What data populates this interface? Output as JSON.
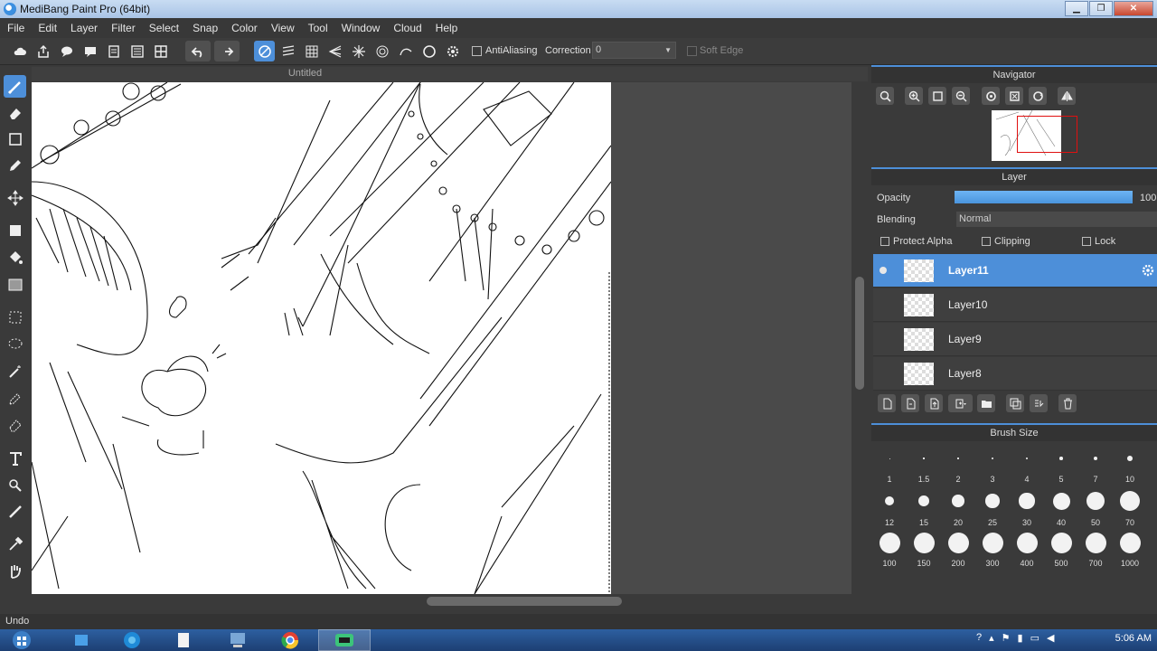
{
  "window": {
    "title": "MediBang Paint Pro (64bit)"
  },
  "menu": [
    "File",
    "Edit",
    "Layer",
    "Filter",
    "Select",
    "Snap",
    "Color",
    "View",
    "Tool",
    "Window",
    "Cloud",
    "Help"
  ],
  "toolbar": {
    "antialiasing_label": "AntiAliasing",
    "correction_label": "Correction",
    "correction_value": "0",
    "soft_edge_label": "Soft Edge"
  },
  "document": {
    "tab_title": "Untitled"
  },
  "navigator": {
    "title": "Navigator"
  },
  "layer_panel": {
    "title": "Layer",
    "opacity_label": "Opacity",
    "opacity_value": "100",
    "blending_label": "Blending",
    "blending_value": "Normal",
    "protect_alpha_label": "Protect Alpha",
    "clipping_label": "Clipping",
    "lock_label": "Lock",
    "layers": [
      {
        "name": "Layer11",
        "selected": true
      },
      {
        "name": "Layer10",
        "selected": false
      },
      {
        "name": "Layer9",
        "selected": false
      },
      {
        "name": "Layer8",
        "selected": false
      }
    ]
  },
  "brush_size": {
    "title": "Brush Size",
    "sizes": [
      "1",
      "1.5",
      "2",
      "3",
      "4",
      "5",
      "7",
      "10",
      "12",
      "15",
      "20",
      "25",
      "30",
      "40",
      "50",
      "70",
      "100",
      "150",
      "200",
      "300",
      "400",
      "500",
      "700",
      "1000"
    ]
  },
  "status": {
    "text": "Undo"
  },
  "taskbar": {
    "time": "5:06 AM"
  },
  "colors": {
    "accent": "#4d8fd9",
    "panel": "#3a3a3a",
    "nav_rect": "#e01010"
  }
}
